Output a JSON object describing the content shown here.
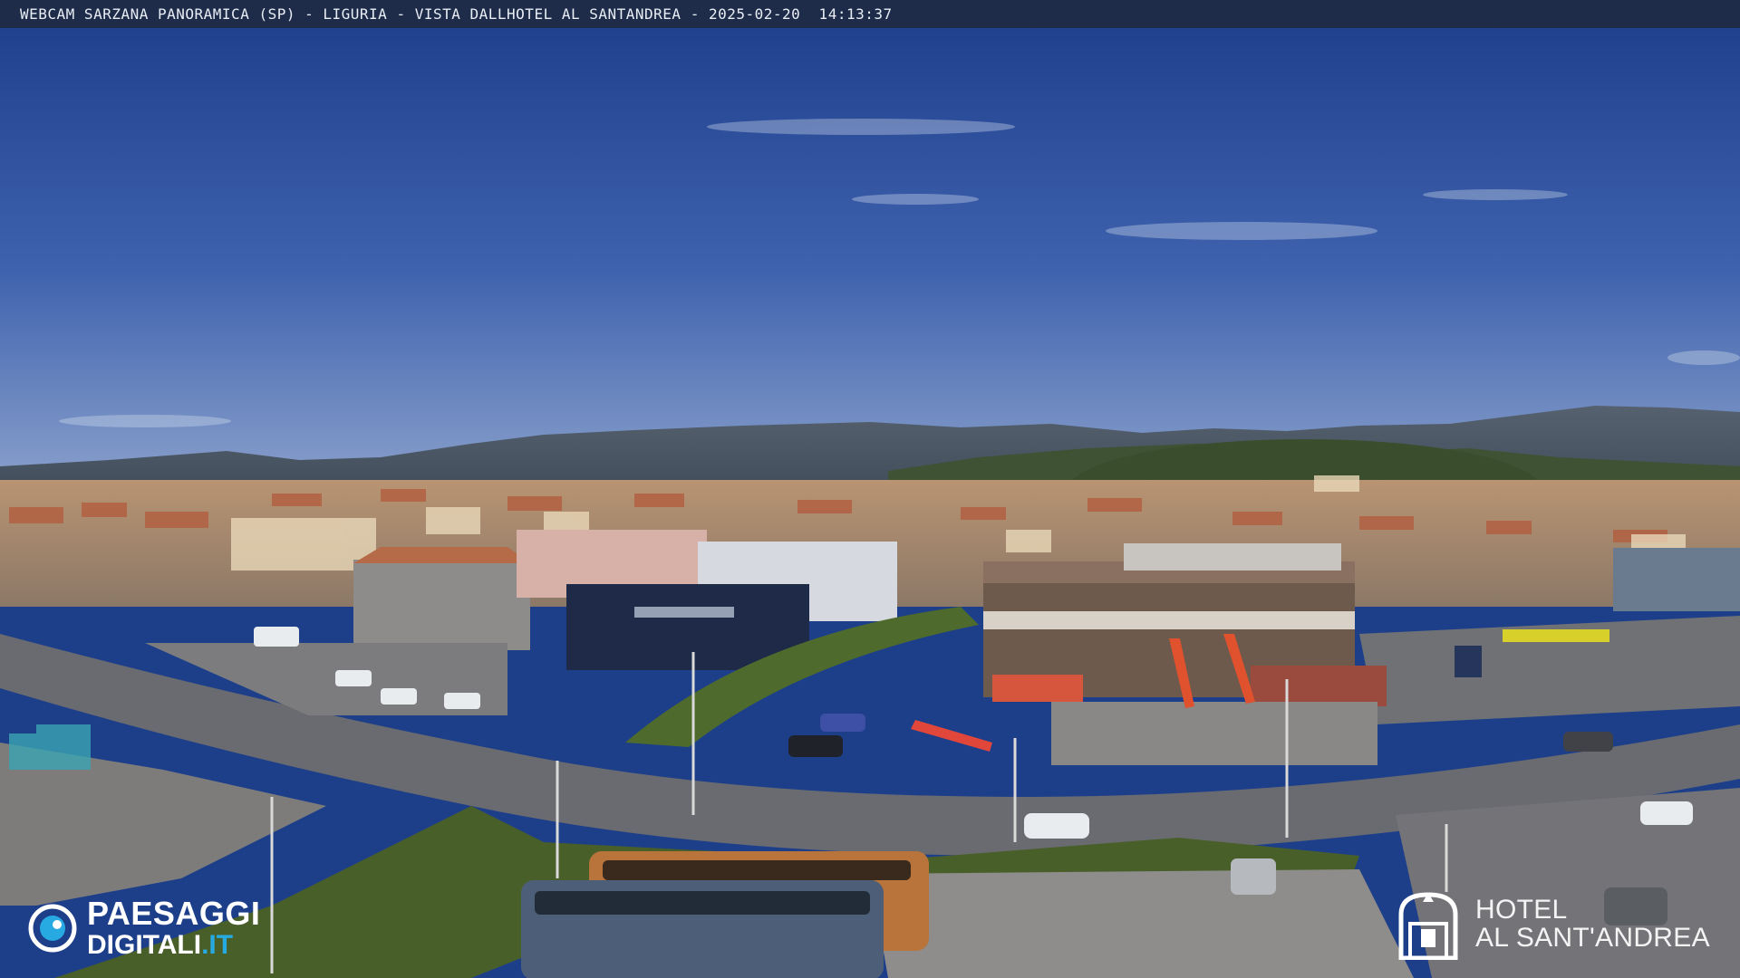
{
  "overlay": {
    "caption": "WEBCAM SARZANA PANORAMICA (SP) - LIGURIA - VISTA DALLHOTEL AL SANTANDREA - 2025-02-20  14:13:37"
  },
  "logos": {
    "left": {
      "line1": "PAESAGGI",
      "line2_main": "DIGITALI",
      "line2_suffix": ".IT"
    },
    "right": {
      "line1": "HOTEL",
      "line2": "AL SANT'ANDREA"
    }
  },
  "colors": {
    "sky_top": "#1f3f8c",
    "sky_bottom": "#6a86bd",
    "hills": "#4a5866",
    "town": "#c9a07a",
    "road": "#6f6f73",
    "grass": "#4f6a2c",
    "logo_accent": "#27a9e1"
  }
}
